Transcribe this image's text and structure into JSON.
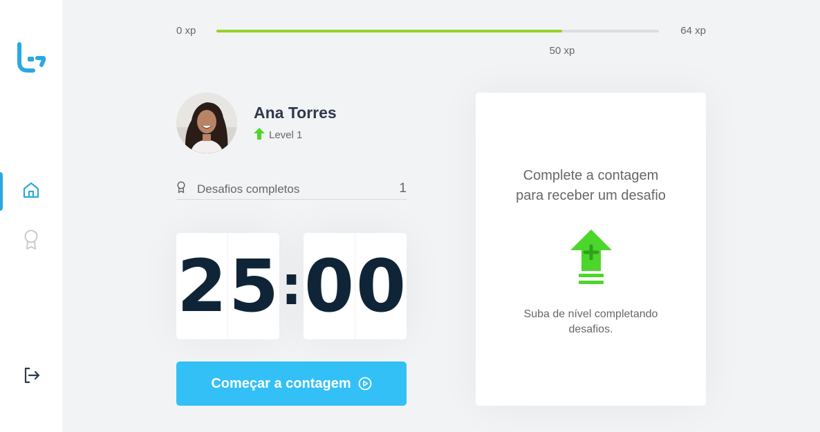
{
  "app": {
    "brand": "brand-logo"
  },
  "sidebar": {
    "items": [
      {
        "name": "home",
        "icon": "home-icon",
        "active": true
      },
      {
        "name": "award",
        "icon": "award-icon",
        "active": false
      }
    ],
    "logout_icon": "logout-icon"
  },
  "xp": {
    "min_label": "0 xp",
    "max_label": "64 xp",
    "current_label": "50 xp",
    "current": 50,
    "max": 64
  },
  "profile": {
    "name": "Ana Torres",
    "level_label": "Level 1"
  },
  "challenges": {
    "label": "Desafios completos",
    "count": "1"
  },
  "countdown": {
    "minute_left": "2",
    "minute_right": "5",
    "separator": ":",
    "second_left": "0",
    "second_right": "0"
  },
  "start_button": {
    "label": "Começar a contagem"
  },
  "challenge_box": {
    "title_line1": "Complete a contagem",
    "title_line2": "para receber um desafio",
    "description_line1": "Suba de nível completando",
    "description_line2": "desafios."
  },
  "colors": {
    "accent": "#33c0f7",
    "brand": "#2aa9e0",
    "xp_fill": "#95d12a",
    "level_up": "#4cd62b",
    "text_dark": "#2e384d",
    "digits": "#0f2537"
  }
}
